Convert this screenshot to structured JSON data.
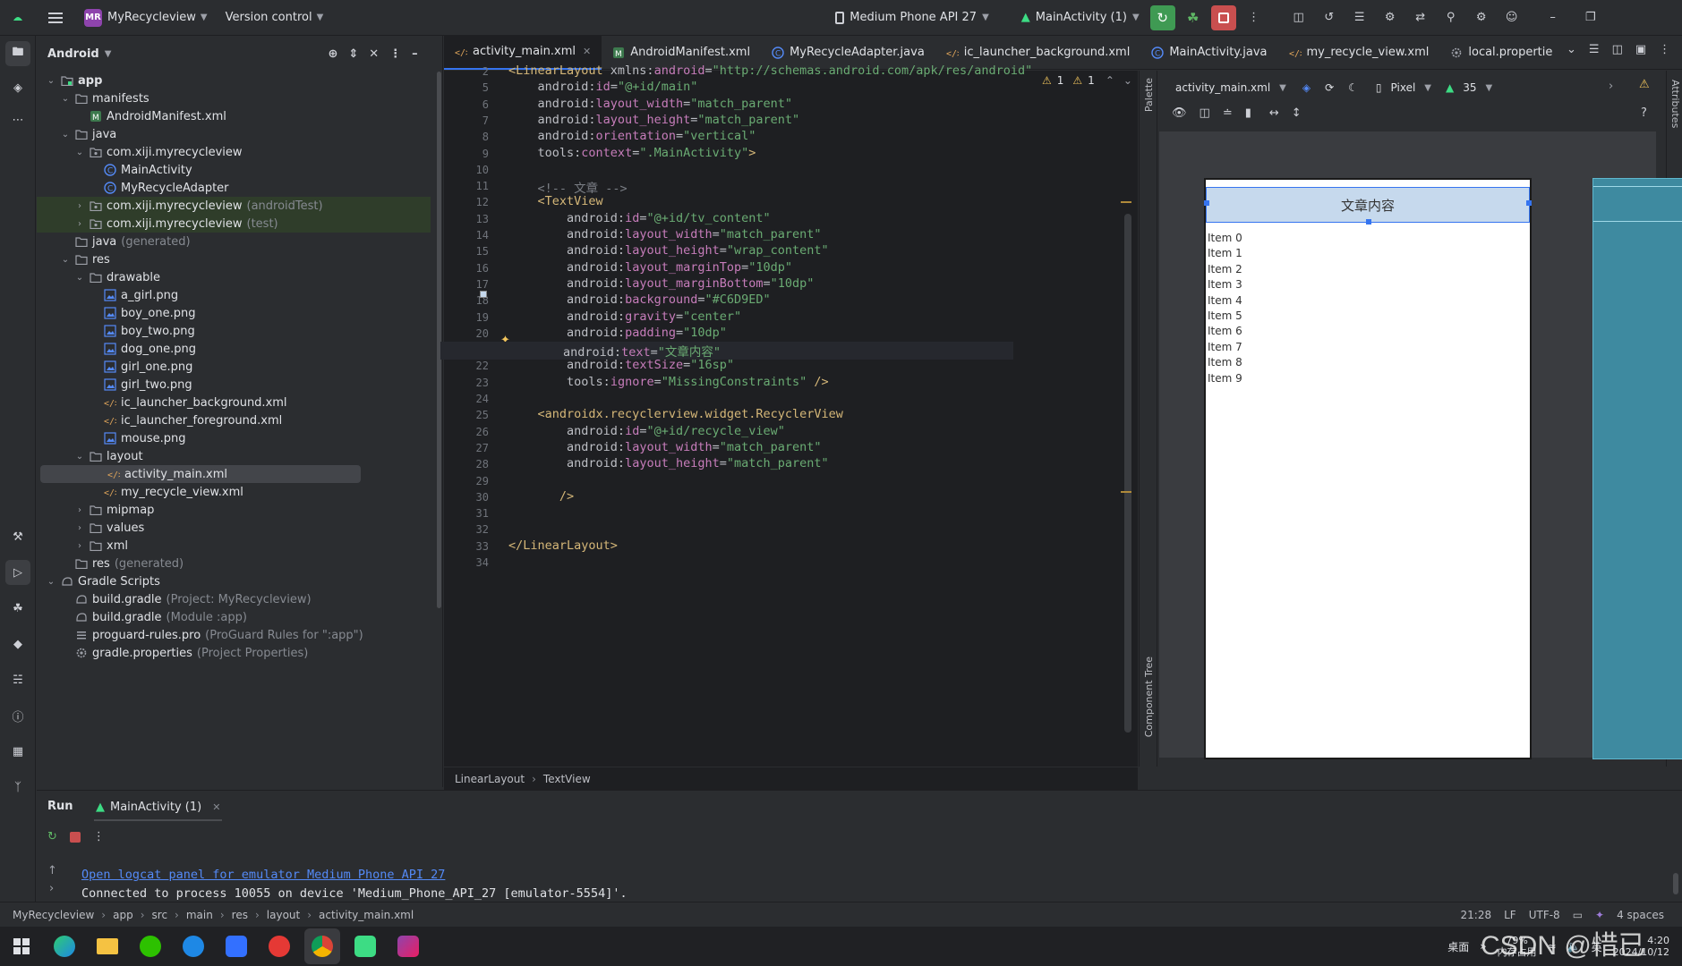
{
  "titlebar": {
    "project_badge": "MR",
    "project": "MyRecycleview",
    "vcs": "Version control",
    "device": "Medium Phone API 27",
    "run_config": "MainActivity (1)"
  },
  "project_panel": {
    "view": "Android",
    "tree": [
      {
        "label": "app",
        "extra": "",
        "depth": 0,
        "arrow": "v",
        "icon": "folder-module-icon",
        "bold": true
      },
      {
        "label": "manifests",
        "extra": "",
        "depth": 1,
        "arrow": "v",
        "icon": "folder-icon"
      },
      {
        "label": "AndroidManifest.xml",
        "extra": "",
        "depth": 2,
        "arrow": "",
        "icon": "manifest-file-icon"
      },
      {
        "label": "java",
        "extra": "",
        "depth": 1,
        "arrow": "v",
        "icon": "folder-icon"
      },
      {
        "label": "com.xiji.myrecycleview",
        "extra": "",
        "depth": 2,
        "arrow": "v",
        "icon": "package-icon"
      },
      {
        "label": "MainActivity",
        "extra": "",
        "depth": 3,
        "arrow": "",
        "icon": "class-icon"
      },
      {
        "label": "MyRecycleAdapter",
        "extra": "",
        "depth": 3,
        "arrow": "",
        "icon": "class-icon"
      },
      {
        "label": "com.xiji.myrecycleview",
        "extra": "(androidTest)",
        "depth": 2,
        "arrow": ">",
        "icon": "package-icon",
        "hl": true
      },
      {
        "label": "com.xiji.myrecycleview",
        "extra": "(test)",
        "depth": 2,
        "arrow": ">",
        "icon": "package-icon",
        "hl": true
      },
      {
        "label": "java",
        "extra": "(generated)",
        "depth": 1,
        "arrow": "",
        "icon": "folder-icon"
      },
      {
        "label": "res",
        "extra": "",
        "depth": 1,
        "arrow": "v",
        "icon": "folder-icon"
      },
      {
        "label": "drawable",
        "extra": "",
        "depth": 2,
        "arrow": "v",
        "icon": "folder-icon"
      },
      {
        "label": "a_girl.png",
        "extra": "",
        "depth": 3,
        "arrow": "",
        "icon": "image-file-icon"
      },
      {
        "label": "boy_one.png",
        "extra": "",
        "depth": 3,
        "arrow": "",
        "icon": "image-file-icon"
      },
      {
        "label": "boy_two.png",
        "extra": "",
        "depth": 3,
        "arrow": "",
        "icon": "image-file-icon"
      },
      {
        "label": "dog_one.png",
        "extra": "",
        "depth": 3,
        "arrow": "",
        "icon": "image-file-icon"
      },
      {
        "label": "girl_one.png",
        "extra": "",
        "depth": 3,
        "arrow": "",
        "icon": "image-file-icon"
      },
      {
        "label": "girl_two.png",
        "extra": "",
        "depth": 3,
        "arrow": "",
        "icon": "image-file-icon"
      },
      {
        "label": "ic_launcher_background.xml",
        "extra": "",
        "depth": 3,
        "arrow": "",
        "icon": "xml-file-icon"
      },
      {
        "label": "ic_launcher_foreground.xml",
        "extra": "",
        "depth": 3,
        "arrow": "",
        "icon": "xml-file-icon"
      },
      {
        "label": "mouse.png",
        "extra": "",
        "depth": 3,
        "arrow": "",
        "icon": "image-file-icon"
      },
      {
        "label": "layout",
        "extra": "",
        "depth": 2,
        "arrow": "v",
        "icon": "folder-icon"
      },
      {
        "label": "activity_main.xml",
        "extra": "",
        "depth": 3,
        "arrow": "",
        "icon": "xml-file-icon",
        "selected": true
      },
      {
        "label": "my_recycle_view.xml",
        "extra": "",
        "depth": 3,
        "arrow": "",
        "icon": "xml-file-icon"
      },
      {
        "label": "mipmap",
        "extra": "",
        "depth": 2,
        "arrow": ">",
        "icon": "folder-icon"
      },
      {
        "label": "values",
        "extra": "",
        "depth": 2,
        "arrow": ">",
        "icon": "folder-icon"
      },
      {
        "label": "xml",
        "extra": "",
        "depth": 2,
        "arrow": ">",
        "icon": "folder-icon"
      },
      {
        "label": "res",
        "extra": "(generated)",
        "depth": 1,
        "arrow": "",
        "icon": "folder-icon"
      },
      {
        "label": "Gradle Scripts",
        "extra": "",
        "depth": 0,
        "arrow": "v",
        "icon": "gradle-icon"
      },
      {
        "label": "build.gradle",
        "extra": "(Project: MyRecycleview)",
        "depth": 1,
        "arrow": "",
        "icon": "gradle-icon"
      },
      {
        "label": "build.gradle",
        "extra": "(Module :app)",
        "depth": 1,
        "arrow": "",
        "icon": "gradle-icon"
      },
      {
        "label": "proguard-rules.pro",
        "extra": "(ProGuard Rules for \":app\")",
        "depth": 1,
        "arrow": "",
        "icon": "text-file-icon"
      },
      {
        "label": "gradle.properties",
        "extra": "(Project Properties)",
        "depth": 1,
        "arrow": "",
        "icon": "settings-file-icon"
      }
    ]
  },
  "tabs": [
    {
      "label": "activity_main.xml",
      "icon": "xml-file-icon",
      "active": true
    },
    {
      "label": "AndroidManifest.xml",
      "icon": "manifest-file-icon"
    },
    {
      "label": "MyRecycleAdapter.java",
      "icon": "class-icon"
    },
    {
      "label": "ic_launcher_background.xml",
      "icon": "xml-file-icon"
    },
    {
      "label": "MainActivity.java",
      "icon": "class-icon"
    },
    {
      "label": "my_recycle_view.xml",
      "icon": "xml-file-icon"
    },
    {
      "label": "local.propertie",
      "icon": "settings-file-icon"
    }
  ],
  "editor": {
    "inspections": {
      "warn1": "1",
      "warn2": "1"
    },
    "lines": [
      {
        "n": "2",
        "parts": [
          [
            "tag",
            "<LinearLayout "
          ],
          [
            "ns",
            "xmlns:"
          ],
          [
            "attr",
            "android"
          ],
          [
            "txt",
            "="
          ],
          [
            "val",
            "\"http://schemas.android.com/apk/res/android\""
          ]
        ]
      },
      {
        "n": "5",
        "parts": [
          [
            "ind",
            "    "
          ],
          [
            "ns",
            "android:"
          ],
          [
            "attr",
            "id"
          ],
          [
            "txt",
            "="
          ],
          [
            "val",
            "\"@+id/main\""
          ]
        ]
      },
      {
        "n": "6",
        "parts": [
          [
            "ind",
            "    "
          ],
          [
            "ns",
            "android:"
          ],
          [
            "attr",
            "layout_width"
          ],
          [
            "txt",
            "="
          ],
          [
            "val",
            "\"match_parent\""
          ]
        ]
      },
      {
        "n": "7",
        "parts": [
          [
            "ind",
            "    "
          ],
          [
            "ns",
            "android:"
          ],
          [
            "attr",
            "layout_height"
          ],
          [
            "txt",
            "="
          ],
          [
            "val",
            "\"match_parent\""
          ]
        ]
      },
      {
        "n": "8",
        "parts": [
          [
            "ind",
            "    "
          ],
          [
            "ns",
            "android:"
          ],
          [
            "attr",
            "orientation"
          ],
          [
            "txt",
            "="
          ],
          [
            "val",
            "\"vertical\""
          ]
        ]
      },
      {
        "n": "9",
        "parts": [
          [
            "ind",
            "    "
          ],
          [
            "ns",
            "tools:"
          ],
          [
            "attr",
            "context"
          ],
          [
            "txt",
            "="
          ],
          [
            "val",
            "\".MainActivity\""
          ],
          [
            "tag",
            ">"
          ]
        ]
      },
      {
        "n": "10",
        "parts": []
      },
      {
        "n": "11",
        "parts": [
          [
            "ind",
            "    "
          ],
          [
            "com",
            "<!-- 文章 -->"
          ]
        ]
      },
      {
        "n": "12",
        "parts": [
          [
            "ind",
            "    "
          ],
          [
            "tag",
            "<TextView"
          ]
        ]
      },
      {
        "n": "13",
        "parts": [
          [
            "ind",
            "        "
          ],
          [
            "ns",
            "android:"
          ],
          [
            "attr",
            "id"
          ],
          [
            "txt",
            "="
          ],
          [
            "val",
            "\"@+id/tv_content\""
          ]
        ]
      },
      {
        "n": "14",
        "parts": [
          [
            "ind",
            "        "
          ],
          [
            "ns",
            "android:"
          ],
          [
            "attr",
            "layout_width"
          ],
          [
            "txt",
            "="
          ],
          [
            "val",
            "\"match_parent\""
          ]
        ]
      },
      {
        "n": "15",
        "parts": [
          [
            "ind",
            "        "
          ],
          [
            "ns",
            "android:"
          ],
          [
            "attr",
            "layout_height"
          ],
          [
            "txt",
            "="
          ],
          [
            "val",
            "\"wrap_content\""
          ]
        ]
      },
      {
        "n": "16",
        "parts": [
          [
            "ind",
            "        "
          ],
          [
            "ns",
            "android:"
          ],
          [
            "attr",
            "layout_marginTop"
          ],
          [
            "txt",
            "="
          ],
          [
            "val",
            "\"10dp\""
          ]
        ]
      },
      {
        "n": "17",
        "parts": [
          [
            "ind",
            "        "
          ],
          [
            "ns",
            "android:"
          ],
          [
            "attr",
            "layout_marginBottom"
          ],
          [
            "txt",
            "="
          ],
          [
            "val",
            "\"10dp\""
          ]
        ]
      },
      {
        "n": "18",
        "parts": [
          [
            "ind",
            "        "
          ],
          [
            "ns",
            "android:"
          ],
          [
            "attr",
            "background"
          ],
          [
            "txt",
            "="
          ],
          [
            "val",
            "\"#C6D9ED\""
          ]
        ]
      },
      {
        "n": "19",
        "parts": [
          [
            "ind",
            "        "
          ],
          [
            "ns",
            "android:"
          ],
          [
            "attr",
            "gravity"
          ],
          [
            "txt",
            "="
          ],
          [
            "val",
            "\"center\""
          ]
        ]
      },
      {
        "n": "20",
        "parts": [
          [
            "ind",
            "        "
          ],
          [
            "ns",
            "android:"
          ],
          [
            "attr",
            "padding"
          ],
          [
            "txt",
            "="
          ],
          [
            "val",
            "\"10dp\""
          ]
        ]
      },
      {
        "n": "21",
        "parts": [
          [
            "ind",
            "        "
          ],
          [
            "ns",
            "android:"
          ],
          [
            "attr",
            "text"
          ],
          [
            "txt",
            "="
          ],
          [
            "val",
            "\"文章内容\""
          ]
        ]
      },
      {
        "n": "22",
        "parts": [
          [
            "ind",
            "        "
          ],
          [
            "ns",
            "android:"
          ],
          [
            "attr",
            "textSize"
          ],
          [
            "txt",
            "="
          ],
          [
            "val",
            "\"16sp\""
          ]
        ]
      },
      {
        "n": "23",
        "parts": [
          [
            "ind",
            "        "
          ],
          [
            "ns",
            "tools:"
          ],
          [
            "attr",
            "ignore"
          ],
          [
            "txt",
            "="
          ],
          [
            "val",
            "\"MissingConstraints\""
          ],
          [
            "tag",
            " />"
          ]
        ]
      },
      {
        "n": "24",
        "parts": []
      },
      {
        "n": "25",
        "parts": [
          [
            "ind",
            "    "
          ],
          [
            "tag",
            "<androidx.recyclerview.widget.RecyclerView"
          ]
        ]
      },
      {
        "n": "26",
        "parts": [
          [
            "ind",
            "        "
          ],
          [
            "ns",
            "android:"
          ],
          [
            "attr",
            "id"
          ],
          [
            "txt",
            "="
          ],
          [
            "val",
            "\"@+id/recycle_view\""
          ]
        ]
      },
      {
        "n": "27",
        "parts": [
          [
            "ind",
            "        "
          ],
          [
            "ns",
            "android:"
          ],
          [
            "attr",
            "layout_width"
          ],
          [
            "txt",
            "="
          ],
          [
            "val",
            "\"match_parent\""
          ]
        ]
      },
      {
        "n": "28",
        "parts": [
          [
            "ind",
            "        "
          ],
          [
            "ns",
            "android:"
          ],
          [
            "attr",
            "layout_height"
          ],
          [
            "txt",
            "="
          ],
          [
            "val",
            "\"match_parent\""
          ]
        ]
      },
      {
        "n": "29",
        "parts": []
      },
      {
        "n": "30",
        "parts": [
          [
            "ind",
            "       "
          ],
          [
            "tag",
            "/>"
          ]
        ]
      },
      {
        "n": "31",
        "parts": []
      },
      {
        "n": "32",
        "parts": []
      },
      {
        "n": "33",
        "parts": [
          [
            "tag",
            "</LinearLayout>"
          ]
        ]
      },
      {
        "n": "34",
        "parts": []
      }
    ],
    "breadcrumb": [
      "LinearLayout",
      "TextView"
    ]
  },
  "design": {
    "file": "activity_main.xml",
    "device": "Pixel",
    "api": "35",
    "palette": "Palette",
    "component_tree": "Component Tree",
    "attributes": "Attributes",
    "help": "?",
    "preview": {
      "header_text": "文章内容",
      "header_bg": "#C6D9ED",
      "items": [
        "Item 0",
        "Item 1",
        "Item 2",
        "Item 3",
        "Item 4",
        "Item 5",
        "Item 6",
        "Item 7",
        "Item 8",
        "Item 9"
      ]
    }
  },
  "run": {
    "title": "Run",
    "tab": "MainActivity (1)",
    "link": "Open logcat panel for emulator Medium Phone API 27",
    "message": "Connected to process 10055 on device 'Medium_Phone_API_27 [emulator-5554]'."
  },
  "statusbar": {
    "path": [
      "MyRecycleview",
      "app",
      "src",
      "main",
      "res",
      "layout",
      "activity_main.xml"
    ],
    "pos": "21:28",
    "lf": "LF",
    "enc": "UTF-8",
    "indent": "4 spaces"
  },
  "taskbar": {
    "desktop": "桌面",
    "mem_pct": "79%",
    "mem_label": "内存占用",
    "lang": "英",
    "time": "4:20",
    "date": "2024/10/12",
    "watermark": "CSDN @惜已"
  }
}
